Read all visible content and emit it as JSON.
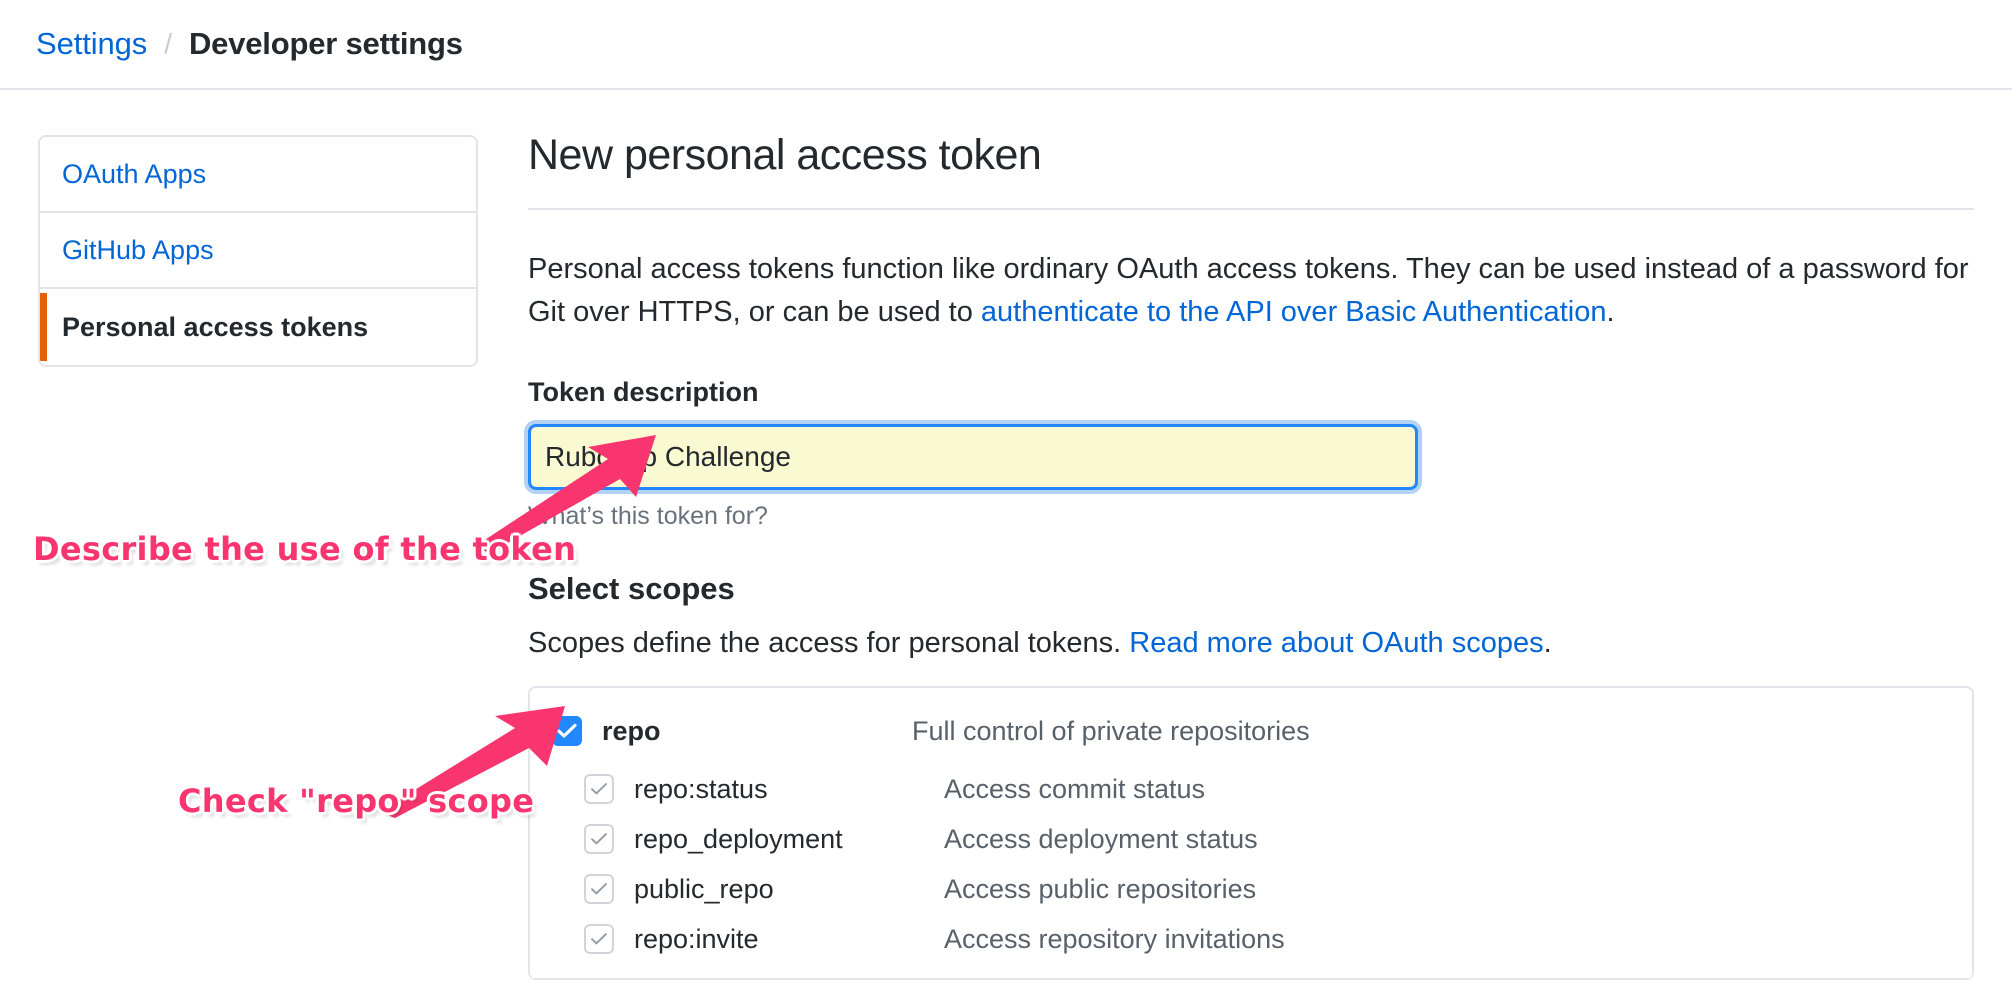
{
  "breadcrumb": {
    "root_label": "Settings",
    "separator": "/",
    "current_label": "Developer settings"
  },
  "sidebar": {
    "items": [
      {
        "label": "OAuth Apps",
        "active": false
      },
      {
        "label": "GitHub Apps",
        "active": false
      },
      {
        "label": "Personal access tokens",
        "active": true
      }
    ]
  },
  "main": {
    "page_title": "New personal access token",
    "intro": {
      "text_before_link": "Personal access tokens function like ordinary OAuth access tokens. They can be used instead of a password for Git over HTTPS, or can be used to ",
      "link_text": "authenticate to the API over Basic Authentication",
      "text_after_link": "."
    },
    "token_description": {
      "label": "Token description",
      "value": "Rubocop Challenge",
      "placeholder": "",
      "hint": "What’s this token for?"
    },
    "scopes_section": {
      "title": "Select scopes",
      "desc_before_link": "Scopes define the access for personal tokens. ",
      "link_text": "Read more about OAuth scopes",
      "desc_after_link": "."
    },
    "scopes": [
      {
        "name": "repo",
        "desc": "Full control of private repositories",
        "level": "parent",
        "checked": true,
        "disabled": false
      },
      {
        "name": "repo:status",
        "desc": "Access commit status",
        "level": "child",
        "checked": true,
        "disabled": true
      },
      {
        "name": "repo_deployment",
        "desc": "Access deployment status",
        "level": "child",
        "checked": true,
        "disabled": true
      },
      {
        "name": "public_repo",
        "desc": "Access public repositories",
        "level": "child",
        "checked": true,
        "disabled": true
      },
      {
        "name": "repo:invite",
        "desc": "Access repository invitations",
        "level": "child",
        "checked": true,
        "disabled": true
      }
    ]
  },
  "annotations": [
    {
      "id": "annot-describe",
      "text": "Describe the use of the token"
    },
    {
      "id": "annot-checkrepo",
      "text": "Check \"repo\" scope"
    }
  ],
  "colors": {
    "link": "#0366d6",
    "active_marker": "#e36209",
    "annotation": "#f8356f",
    "checkbox_checked": "#2188ff",
    "input_background": "#fafad2",
    "border": "#e1e4e8"
  }
}
